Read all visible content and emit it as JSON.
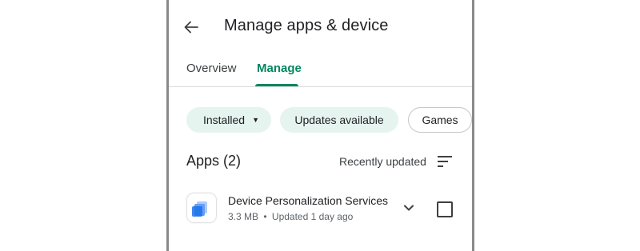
{
  "header": {
    "back_icon": "arrow-left-icon",
    "title": "Manage apps & device"
  },
  "tabs": [
    {
      "label": "Overview",
      "selected": false
    },
    {
      "label": "Manage",
      "selected": true
    }
  ],
  "filters": {
    "installed": {
      "label": "Installed",
      "icon": "dropdown-caret-icon"
    },
    "updates": {
      "label": "Updates available"
    },
    "games": {
      "label": "Games"
    }
  },
  "apps_section": {
    "heading": "Apps (2)",
    "sort_label": "Recently updated",
    "sort_icon": "sort-icon"
  },
  "apps": [
    {
      "name": "Device Personalization Services",
      "size": "3.3 MB",
      "separator": "•",
      "updated": "Updated 1 day ago",
      "checked": false
    }
  ],
  "colors": {
    "accent": "#01875f",
    "chip_bg": "#e6f4ef",
    "text_primary": "#202124",
    "text_secondary": "#5f6368"
  }
}
